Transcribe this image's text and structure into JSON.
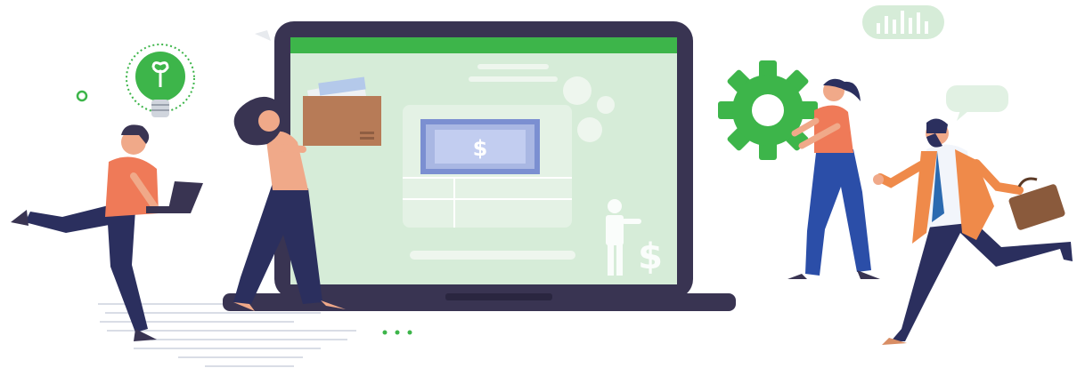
{
  "illustration": {
    "banknote_symbol": "$",
    "payroll_symbol": "$",
    "colors": {
      "brand_green": "#3db54a",
      "screen_bg": "#d6ecd8",
      "laptop_frame": "#393452",
      "banknote_fill": "#a9b7e3",
      "banknote_border": "#7b8fd1",
      "navy": "#2b2f5e",
      "skin": "#f0a989",
      "orange_shirt": "#ef7a58",
      "box": "#b77b57",
      "light_gray": "#e7eaee"
    },
    "icons": [
      "lightbulb-icon",
      "gear-icon",
      "bar-chart-icon",
      "speech-bubble-icon",
      "briefcase-icon",
      "laptop-icon",
      "banknote-icon",
      "payroll-person-icon",
      "dots-icon"
    ]
  }
}
